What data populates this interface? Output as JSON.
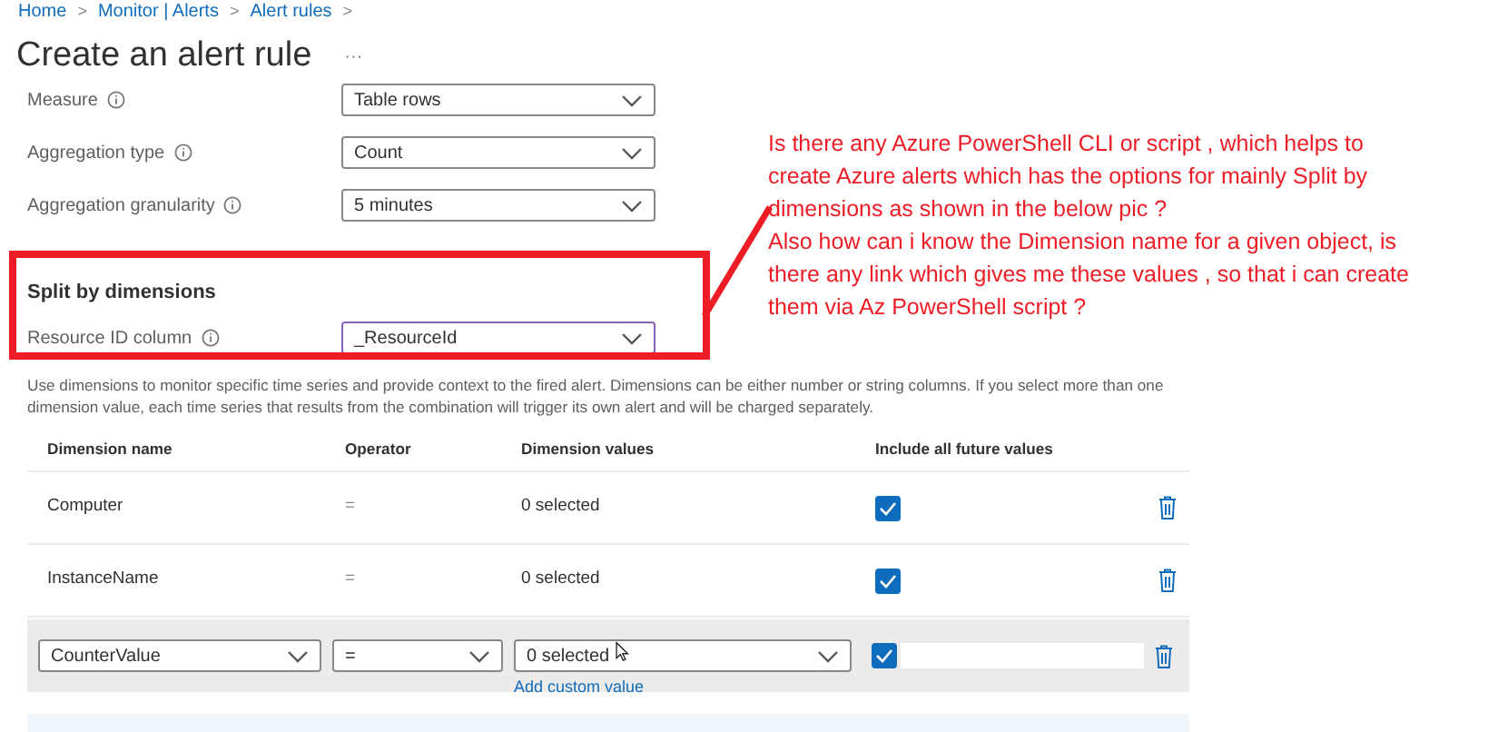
{
  "breadcrumb": [
    {
      "label": "Home",
      "separator": ">"
    },
    {
      "label": "Monitor | Alerts",
      "separator": ">"
    },
    {
      "label": "Alert rules",
      "separator": ">"
    }
  ],
  "title": "Create an alert rule",
  "more": "···",
  "fields": [
    {
      "label": "Measure",
      "value": "Table rows"
    },
    {
      "label": "Aggregation type",
      "value": "Count"
    },
    {
      "label": "Aggregation granularity",
      "value": "5 minutes"
    }
  ],
  "split": {
    "title": "Split by dimensions",
    "field": {
      "label": "Resource ID column",
      "value": "_ResourceId"
    }
  },
  "description": "Use dimensions to monitor specific time series and provide context to the fired alert. Dimensions can be either number or string columns. If you select more than one dimension value, each time series that results from the combination will trigger its own alert and will be charged separately.",
  "table": {
    "columns": [
      "Dimension name",
      "Operator",
      "Dimension values",
      "Include all future values"
    ],
    "rows": [
      {
        "kind": "static",
        "name": "Computer",
        "operator": "=",
        "values": "0 selected",
        "include": true
      },
      {
        "kind": "static",
        "name": "InstanceName",
        "operator": "=",
        "values": "0 selected",
        "include": true
      },
      {
        "kind": "edit",
        "name": "CounterValue",
        "operator": "=",
        "values": "0 selected",
        "include": true,
        "link": "Add custom value"
      }
    ]
  },
  "annotation": [
    "Is there any Azure PowerShell CLI or script , which helps to create Azure alerts which has the options for mainly Split by dimensions as shown in the below pic ?",
    "Also how can i know the Dimension name for a given object, is there any link which gives me these values , so that i can create them via Az PowerShell script ?"
  ]
}
